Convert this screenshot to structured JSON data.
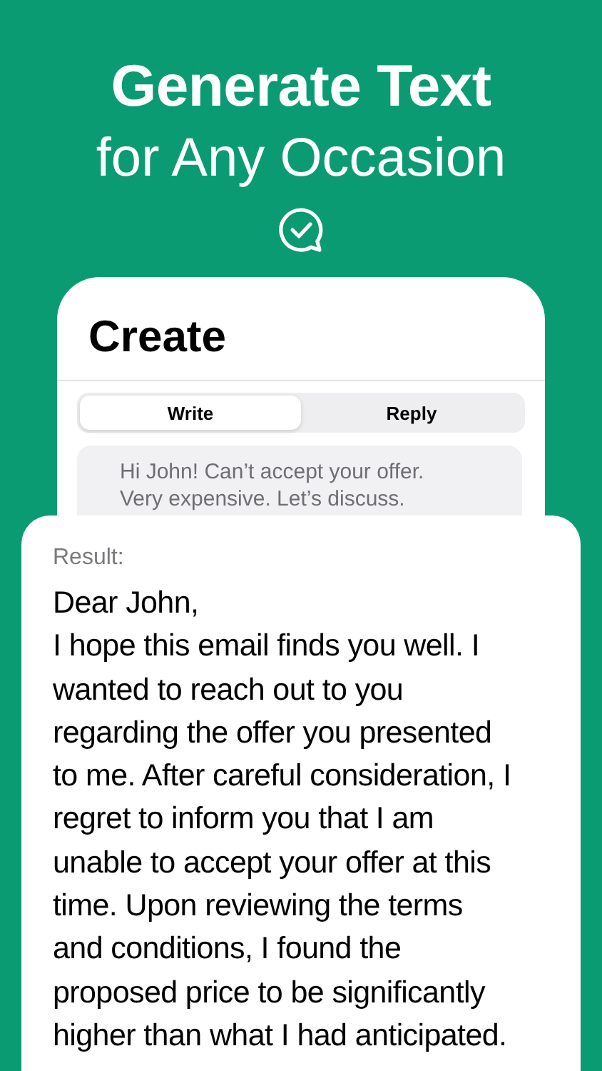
{
  "headline": {
    "title": "Generate Text",
    "subtitle": "for Any Occasion"
  },
  "screen": {
    "title": "Create",
    "tabs": [
      {
        "label": "Write",
        "selected": true
      },
      {
        "label": "Reply",
        "selected": false
      }
    ],
    "input": {
      "value": "Hi John! Can’t accept your offer. Very expensive. Let’s discuss."
    }
  },
  "result": {
    "label": "Result:",
    "greeting": "Dear John,",
    "body_lines": [
      "I hope this email finds you well. I",
      "wanted to reach out to you",
      "regarding the offer you presented",
      "to me. After careful consideration, I",
      "regret to inform you that I am",
      "unable to accept your offer at this",
      "time. Upon reviewing the terms",
      "and conditions, I found the",
      "proposed price to be significantly",
      "higher than what I had anticipated."
    ]
  }
}
